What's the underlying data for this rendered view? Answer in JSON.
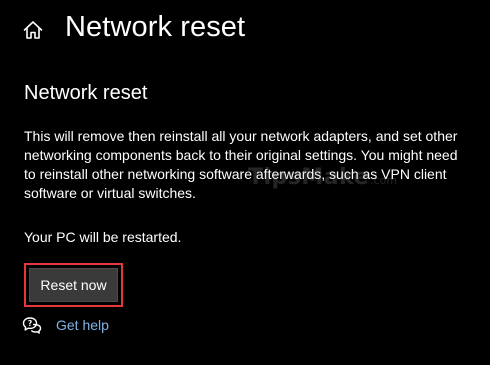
{
  "header": {
    "title": "Network reset",
    "home_icon": "home-icon"
  },
  "section": {
    "title": "Network reset",
    "description": "This will remove then reinstall all your network adapters, and set other networking components back to their original settings. You might need to reinstall other networking software afterwards, such as VPN client software or virtual switches.",
    "restart_note": "Your PC will be restarted."
  },
  "actions": {
    "reset_label": "Reset now",
    "highlight_color": "#e5383b"
  },
  "help": {
    "icon": "help-chat-icon",
    "label": "Get help"
  },
  "watermark": {
    "main": "TipsMake",
    "suffix": ".com"
  },
  "colors": {
    "background": "#000000",
    "text": "#ffffff",
    "button": "#3a3a3a",
    "link": "#7fb2e6"
  }
}
